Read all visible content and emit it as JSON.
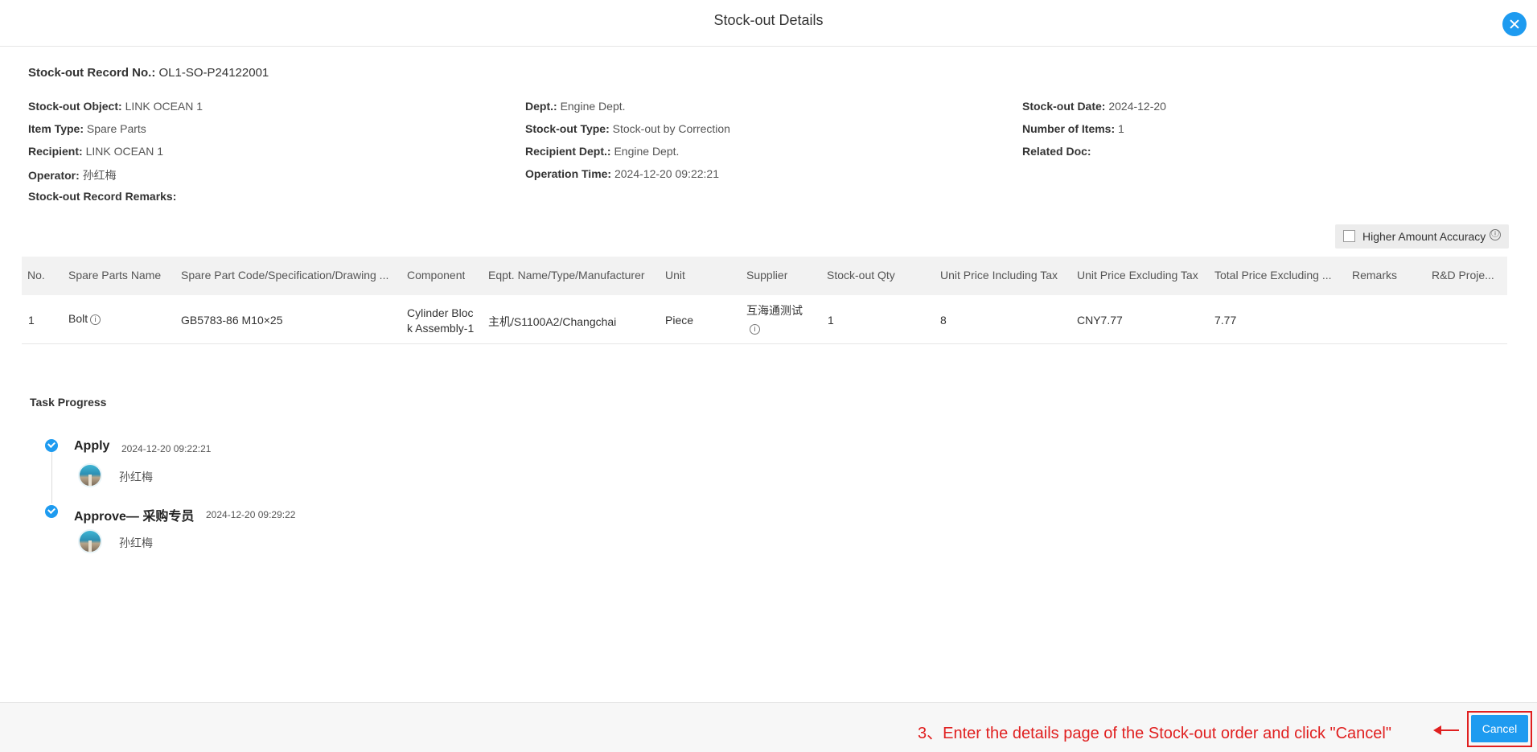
{
  "dialog": {
    "title": "Stock-out Details",
    "close_icon": "close-icon"
  },
  "record": {
    "label": "Stock-out Record No.:",
    "value": "OL1-SO-P24122001"
  },
  "info": {
    "stockout_object": {
      "label": "Stock-out Object:",
      "value": "LINK OCEAN 1"
    },
    "item_type": {
      "label": "Item Type:",
      "value": "Spare Parts"
    },
    "recipient": {
      "label": "Recipient:",
      "value": "LINK OCEAN 1"
    },
    "operator": {
      "label": "Operator:",
      "value": "孙红梅"
    },
    "remarks": {
      "label": "Stock-out Record Remarks:",
      "value": ""
    },
    "dept": {
      "label": "Dept.:",
      "value": "Engine Dept."
    },
    "stockout_type": {
      "label": "Stock-out Type:",
      "value": "Stock-out by Correction"
    },
    "recipient_dept": {
      "label": "Recipient Dept.:",
      "value": "Engine Dept."
    },
    "operation_time": {
      "label": "Operation Time:",
      "value": "2024-12-20 09:22:21"
    },
    "stockout_date": {
      "label": "Stock-out Date:",
      "value": "2024-12-20"
    },
    "number_of_items": {
      "label": "Number of Items:",
      "value": "1"
    },
    "related_doc": {
      "label": "Related Doc:",
      "value": ""
    }
  },
  "accuracy": {
    "label": "Higher Amount Accuracy",
    "info": "ⓘ",
    "checked": false
  },
  "table": {
    "headers": [
      "No.",
      "Spare Parts Name",
      "Spare Part Code/Specification/Drawing ...",
      "Component",
      "Eqpt. Name/Type/Manufacturer",
      "Unit",
      "Supplier",
      "Stock-out Qty",
      "Unit Price Including Tax",
      "Unit Price Excluding Tax",
      "Total Price Excluding ...",
      "Remarks",
      "R&D Proje..."
    ],
    "rows": [
      {
        "no": "1",
        "name": "Bolt",
        "code": "GB5783-86 M10×25",
        "component_line1": "Cylinder Bloc",
        "component_line2": "k Assembly-1",
        "equipment": "主机/S1100A2/Changchai",
        "unit": "Piece",
        "supplier": "互海通测试",
        "qty": "1",
        "price_incl": "8",
        "price_excl": "CNY7.77",
        "total_excl": "7.77",
        "remarks": "",
        "rd_project": ""
      }
    ]
  },
  "task_progress": {
    "title": "Task Progress",
    "steps": [
      {
        "name": "Apply",
        "time": "2024-12-20 09:22:21",
        "user": "孙红梅"
      },
      {
        "name": "Approve— 采购专员",
        "time": "2024-12-20 09:29:22",
        "user": "孙红梅"
      }
    ]
  },
  "footer": {
    "annotation": "3、Enter the details page of the Stock-out order and click \"Cancel\"",
    "cancel_label": "Cancel"
  },
  "colors": {
    "accent": "#1e9bf0",
    "annotation": "#e02020"
  }
}
